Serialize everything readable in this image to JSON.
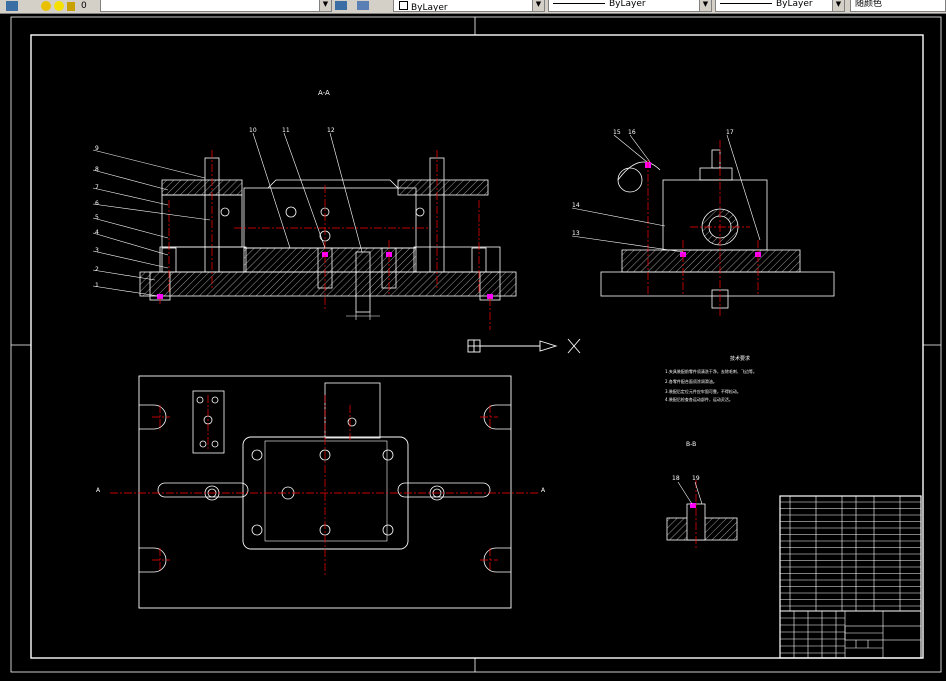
{
  "toolbar": {
    "layer_value": "0",
    "color_control": "ByLayer",
    "linetype_control": "ByLayer",
    "lineweight_control": "ByLayer",
    "plotstyle_control": "随颜色"
  },
  "drawing": {
    "section_aa": "A-A",
    "section_bb": "B-B",
    "view_marker_left": "A",
    "view_marker_right": "A",
    "tech_req_title": "技术要求",
    "tech_req_lines": [
      "1.夹具装配前零件须清洗干净，去除毛刺、飞边等。",
      "2.各零件配合面须涂润滑油。",
      "3.装配后定位元件应牢固可靠，不得松动。",
      "4.装配后检查各运动部件，运动灵活。"
    ],
    "callouts_left": [
      "9",
      "8",
      "7",
      "6",
      "5",
      "4",
      "3",
      "2",
      "1"
    ],
    "callouts_top": [
      "10",
      "11",
      "12"
    ],
    "callouts_right": [
      "15",
      "16",
      "17",
      "14",
      "13"
    ],
    "callouts_bb": [
      "18",
      "19"
    ]
  },
  "colors": {
    "background": "#000000",
    "line": "#ffffff",
    "center": "#ff0000",
    "hatch": "#ffffff",
    "highlight": "#ff00ff"
  }
}
